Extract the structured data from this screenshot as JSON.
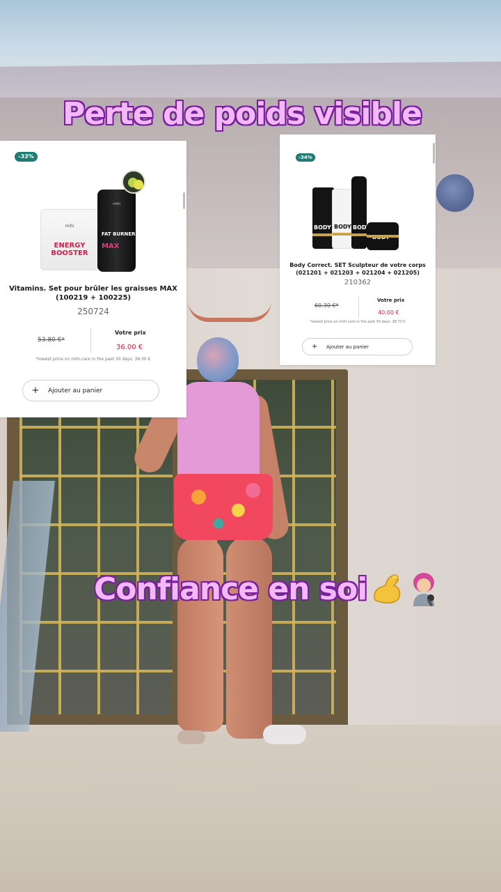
{
  "captions": {
    "top": "Perte de poids visible",
    "bottom": "Confiance en soi"
  },
  "emojis": [
    "flexed-biceps",
    "woman-singer"
  ],
  "colors": {
    "caption_fill": "#f3b8f7",
    "caption_outline": "#7a1ea0",
    "discount_badge": "#1e7c74",
    "sale_price": "#d1243c"
  },
  "products": [
    {
      "discount": "-33%",
      "title": "Vitamins. Set pour brûler les graisses MAX (100219 + 100225)",
      "sku": "250724",
      "old_price": "53.80 €*",
      "price_label": "Votre prix",
      "price": "36.00 €",
      "lowest_note": "*lowest price on mihi.care in the past 30 days: 36.00 €",
      "add_button": "Ajouter au panier",
      "image_text": {
        "jar1_brand": "mihi",
        "jar1_name": "ENERGY BOOSTER",
        "jar2_brand": "mihi",
        "jar2_name_top": "FAT BURNER",
        "jar2_name_bottom": "MAX"
      }
    },
    {
      "discount": "-34%",
      "title": "Body Correct. SET Sculpteur de votre corps (021201 + 021203 + 021204 + 021205)",
      "sku": "210362",
      "old_price": "60.30 €*",
      "price_label": "Votre prix",
      "price": "40.00 €",
      "lowest_note": "*lowest price on mihi.care in the past 30 days: 38.70 €",
      "add_button": "Ajouter au panier",
      "image_text": {
        "label": "BODY"
      }
    }
  ]
}
